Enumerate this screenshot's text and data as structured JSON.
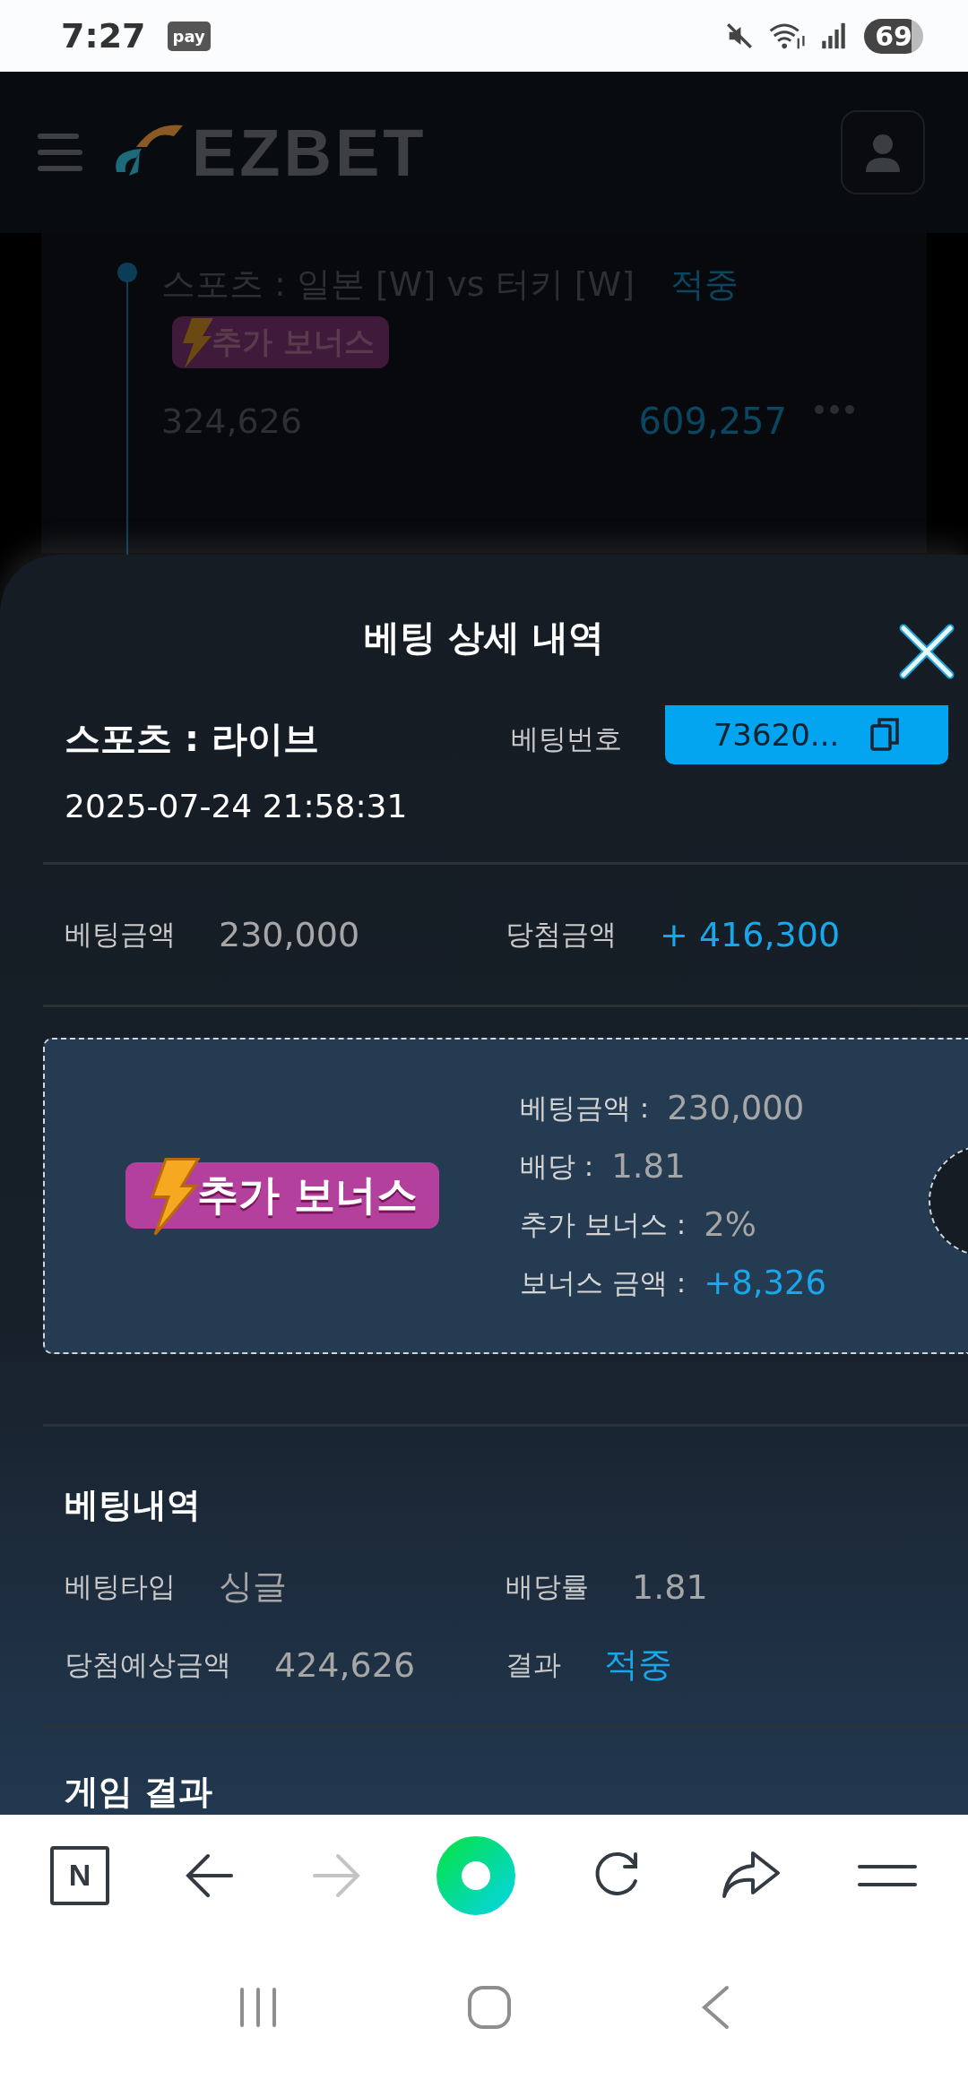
{
  "status_bar": {
    "time": "7:27",
    "pay_badge": "pay",
    "battery": "69"
  },
  "header": {
    "logo": "EZBET"
  },
  "background_bet": {
    "title": "스포츠 : 일본 [W] vs 터키 [W]",
    "result": "적중",
    "badge": "추가 보너스",
    "amount": "324,626",
    "payout": "609,257"
  },
  "sheet": {
    "title": "베팅 상세 내역",
    "category": "스포츠 : 라이브",
    "bet_number_label": "베팅번호",
    "bet_number": "73620...",
    "datetime": "2025-07-24 21:58:31",
    "summary": [
      {
        "label": "베팅금액",
        "value": "230,000",
        "highlight": false
      },
      {
        "label": "당첨금액",
        "value": "+ 416,300",
        "highlight": true
      }
    ],
    "bonus": {
      "badge": "추가 보너스",
      "rows": [
        {
          "label": "베팅금액 :",
          "value": "230,000",
          "highlight": false
        },
        {
          "label": "배당 :",
          "value": "1.81",
          "highlight": false
        },
        {
          "label": "추가 보너스 :",
          "value": "2%",
          "highlight": false
        },
        {
          "label": "보너스 금액 :",
          "value": "+8,326",
          "highlight": true
        }
      ]
    },
    "history": {
      "title": "베팅내역",
      "rows": [
        {
          "label": "베팅타입",
          "value": "싱글",
          "highlight": false
        },
        {
          "label": "배당률",
          "value": "1.81",
          "highlight": false
        },
        {
          "label": "당첨예상금액",
          "value": "424,626",
          "highlight": false
        },
        {
          "label": "결과",
          "value": "적중",
          "highlight": true
        }
      ]
    },
    "game_result_title": "게임 결과"
  },
  "browser_bar": {
    "logo_letter": "N",
    "forward_enabled": false
  }
}
